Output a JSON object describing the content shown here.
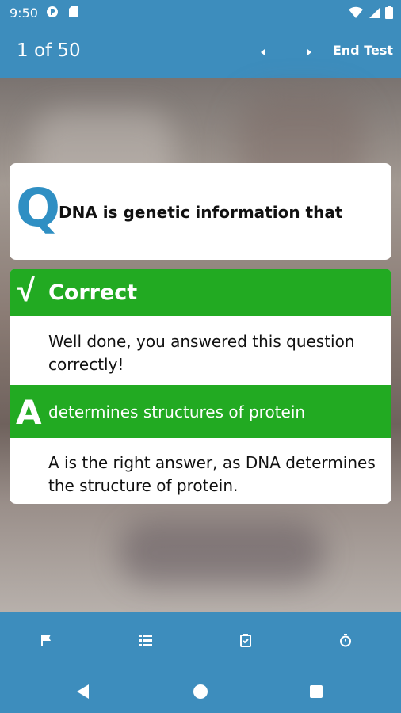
{
  "status_bar": {
    "time": "9:50"
  },
  "header": {
    "counter": "1 of 50",
    "end_test_label": "End Test"
  },
  "question": {
    "letter": "Q",
    "text": "DNA is genetic information that"
  },
  "result": {
    "check": "√",
    "status": "Correct",
    "feedback": "Well done, you answered this question correctly!",
    "answer_letter": "A",
    "answer_text": "determines structures of protein",
    "explanation": "A is the right answer, as DNA determines the structure of protein."
  },
  "bottom_tabs": [
    "flag-icon",
    "list-icon",
    "clipboard-check-icon",
    "stopwatch-icon"
  ],
  "colors": {
    "primary": "#3d8dbd",
    "correct": "#22aa22",
    "q_letter": "#2f8fc3"
  }
}
